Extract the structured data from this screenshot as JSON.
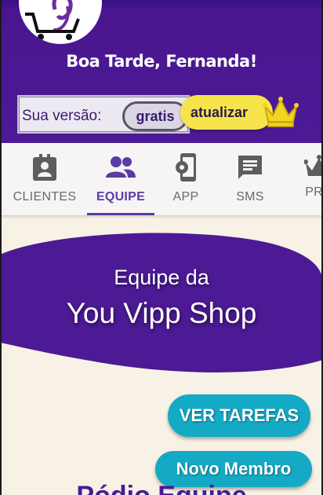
{
  "header": {
    "greeting": "Boa Tarde, Fernanda!",
    "logo_icon": "cart-logo-icon",
    "version_label": "Sua versão:",
    "plan_value": "gratis",
    "upgrade_label": "atualizar",
    "crown_icon": "crown-icon"
  },
  "tabs": [
    {
      "label": "CLIENTES",
      "icon": "contact-badge-icon",
      "active": false
    },
    {
      "label": "EQUIPE",
      "icon": "people-icon",
      "active": true
    },
    {
      "label": "APP",
      "icon": "phone-settings-icon",
      "active": false
    },
    {
      "label": "SMS",
      "icon": "message-icon",
      "active": false
    },
    {
      "label": "PRO",
      "icon": "crown-icon",
      "active": false
    }
  ],
  "main": {
    "team_title": "Equipe da",
    "team_name": "You Vipp Shop",
    "tasks_button": "VER TAREFAS",
    "new_member_button": "Novo Membro",
    "podium_title": "Pódio Equipe"
  },
  "colors": {
    "header_bg": "#4b1a94",
    "accent": "#5b3aa8",
    "button": "#14a9c4",
    "upgrade": "#f6e44a",
    "background": "#f8f1e5"
  }
}
